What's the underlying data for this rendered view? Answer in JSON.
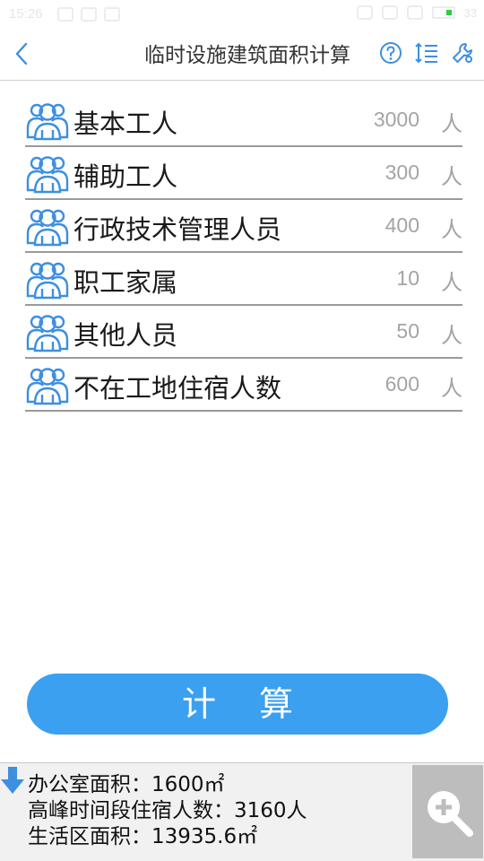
{
  "status_bar": {
    "time": "15:26",
    "battery": "33"
  },
  "header": {
    "title": "临时设施建筑面积计算"
  },
  "colors": {
    "accent": "#3aa0ef",
    "icon_blue": "#3d8fe0",
    "placeholder_gray": "#a4a4a4"
  },
  "fields": [
    {
      "label": "基本工人",
      "value": "3000",
      "unit": "人"
    },
    {
      "label": "辅助工人",
      "value": "300",
      "unit": "人"
    },
    {
      "label": "行政技术管理人员",
      "value": "400",
      "unit": "人"
    },
    {
      "label": "职工家属",
      "value": "10",
      "unit": "人"
    },
    {
      "label": "其他人员",
      "value": "50",
      "unit": "人"
    },
    {
      "label": "不在工地住宿人数",
      "value": "600",
      "unit": "人"
    }
  ],
  "calculate_button": "计 算",
  "results": {
    "office_area": "办公室面积：1600㎡",
    "peak_occupants": "高峰时间段住宿人数：3160人",
    "living_area": "生活区面积：13935.6㎡"
  }
}
